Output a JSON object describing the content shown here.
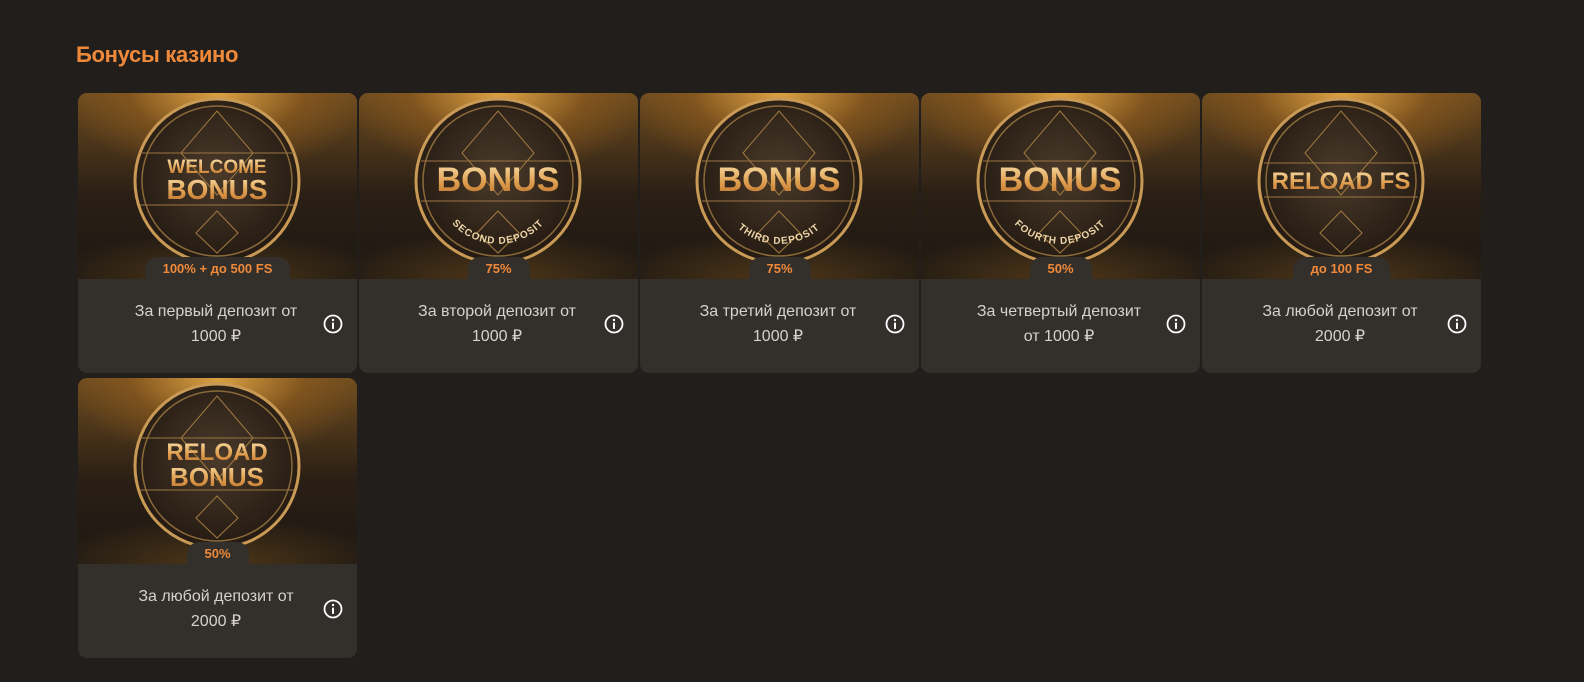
{
  "section": {
    "title": "Бонусы казино"
  },
  "cards": [
    {
      "badge_line1": "WELCOME",
      "badge_line2": "BONUS",
      "badge_arc": "",
      "tab": "100% + до 500 FS",
      "desc_line1": "За первый депозит от",
      "desc_line2": "1000 ₽",
      "info_icon": "info-icon"
    },
    {
      "badge_line1": "",
      "badge_line2": "BONUS",
      "badge_arc": "SECOND DEPOSIT",
      "tab": "75%",
      "desc_line1": "За второй депозит от",
      "desc_line2": "1000 ₽",
      "info_icon": "info-icon"
    },
    {
      "badge_line1": "",
      "badge_line2": "BONUS",
      "badge_arc": "THIRD DEPOSIT",
      "tab": "75%",
      "desc_line1": "За третий депозит от",
      "desc_line2": "1000 ₽",
      "info_icon": "info-icon"
    },
    {
      "badge_line1": "",
      "badge_line2": "BONUS",
      "badge_arc": "FOURTH DEPOSIT",
      "tab": "50%",
      "desc_line1": "За четвертый депозит",
      "desc_line2": "от 1000 ₽",
      "info_icon": "info-icon"
    },
    {
      "badge_line1": "",
      "badge_line2": "RELOAD FS",
      "badge_arc": "",
      "tab": "до 100 FS",
      "desc_line1": "За любой депозит от",
      "desc_line2": "2000 ₽",
      "info_icon": "info-icon"
    },
    {
      "badge_line1": "RELOAD",
      "badge_line2": "BONUS",
      "badge_arc": "",
      "tab": "50%",
      "desc_line1": "За любой депозит от",
      "desc_line2": "2000 ₽",
      "info_icon": "info-icon"
    }
  ],
  "colors": {
    "background": "#211e1b",
    "card": "#332f2b",
    "accent": "#f08a3a",
    "gold": "#e8b05a",
    "text": "#d7d2cc"
  }
}
